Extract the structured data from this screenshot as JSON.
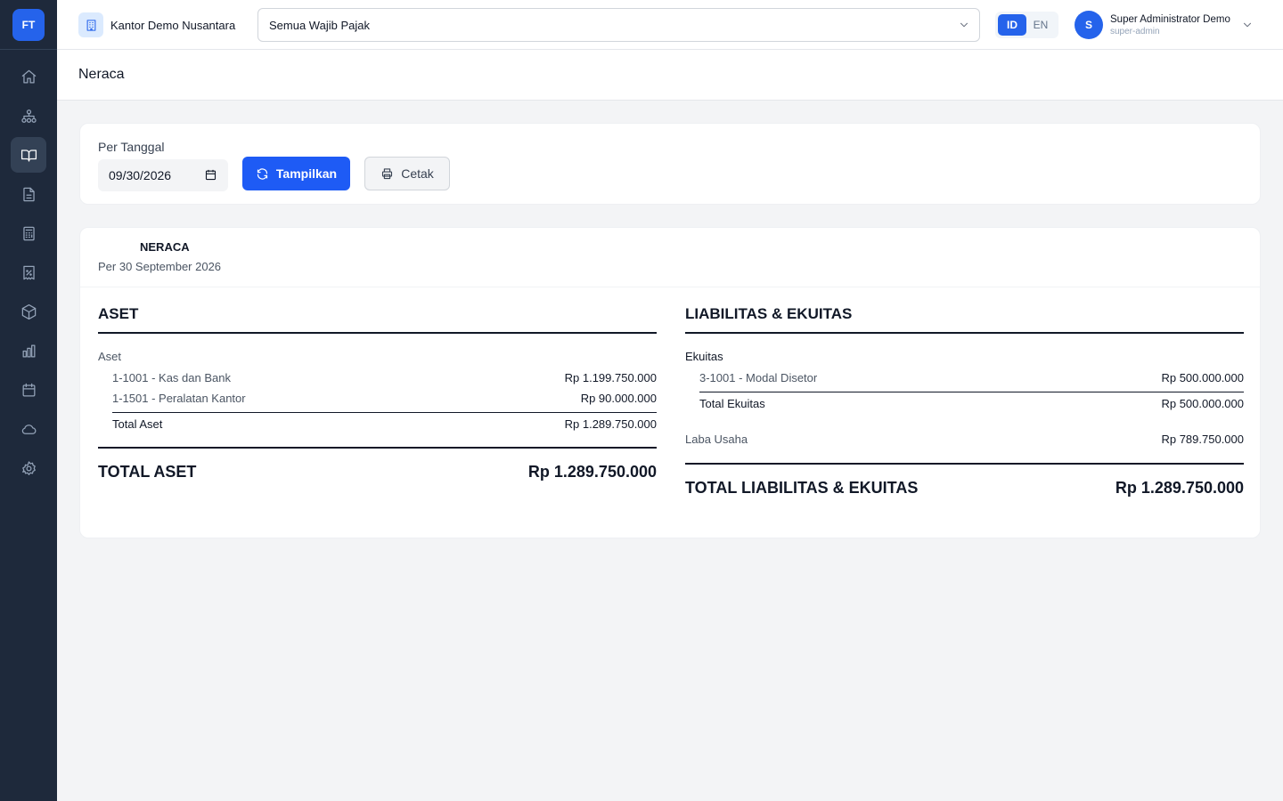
{
  "sidebar": {
    "logo": "FT",
    "items": [
      {
        "name": "home",
        "icon": "home-icon"
      },
      {
        "name": "organization",
        "icon": "sitemap-icon"
      },
      {
        "name": "ledger",
        "icon": "book-icon",
        "active": true
      },
      {
        "name": "documents",
        "icon": "document-icon"
      },
      {
        "name": "calculator",
        "icon": "calculator-icon"
      },
      {
        "name": "tax",
        "icon": "receipt-percent-icon"
      },
      {
        "name": "inventory",
        "icon": "cube-icon"
      },
      {
        "name": "reports",
        "icon": "bar-chart-icon"
      },
      {
        "name": "calendar",
        "icon": "calendar-icon"
      },
      {
        "name": "cloud",
        "icon": "cloud-icon"
      },
      {
        "name": "settings",
        "icon": "gear-icon"
      }
    ]
  },
  "topbar": {
    "office_name": "Kantor Demo Nusantara",
    "taxpayer_select": "Semua Wajib Pajak",
    "lang": {
      "id": "ID",
      "en": "EN",
      "active": "ID"
    },
    "user": {
      "initial": "S",
      "name": "Super Administrator Demo",
      "role": "super-admin"
    }
  },
  "page": {
    "title": "Neraca"
  },
  "filter": {
    "label": "Per Tanggal",
    "date_value": "09/30/2026",
    "show_button": "Tampilkan",
    "print_button": "Cetak"
  },
  "report": {
    "title": "NERACA",
    "date": "Per 30 September 2026",
    "assets": {
      "heading": "ASET",
      "group": "Aset",
      "accounts": [
        {
          "label": "1-1001 - Kas dan Bank",
          "amount": "Rp 1.199.750.000"
        },
        {
          "label": "1-1501 - Peralatan Kantor",
          "amount": "Rp 90.000.000"
        }
      ],
      "subtotal_label": "Total Aset",
      "subtotal_amount": "Rp 1.289.750.000",
      "grand_label": "TOTAL ASET",
      "grand_amount": "Rp 1.289.750.000"
    },
    "liabilities": {
      "heading": "LIABILITAS & EKUITAS",
      "group": "Ekuitas",
      "accounts": [
        {
          "label": "3-1001 - Modal Disetor",
          "amount": "Rp 500.000.000"
        }
      ],
      "subtotal_label": "Total Ekuitas",
      "subtotal_amount": "Rp 500.000.000",
      "profit_label": "Laba Usaha",
      "profit_amount": "Rp 789.750.000",
      "grand_label": "TOTAL LIABILITAS & EKUITAS",
      "grand_amount": "Rp 1.289.750.000"
    }
  }
}
